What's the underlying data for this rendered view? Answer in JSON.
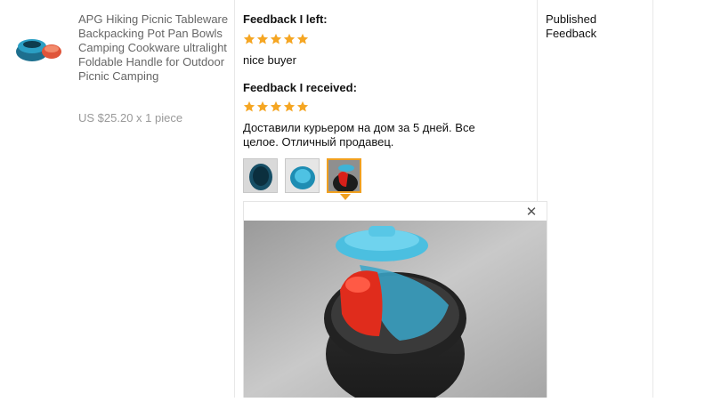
{
  "product": {
    "title": "APG Hiking Picnic Tableware Backpacking Pot Pan Bowls Camping Cookware ultralight Foldable Handle for Outdoor Picnic Camping",
    "price": "US $25.20 x 1 piece",
    "thumbnail_icon": "product-photo"
  },
  "feedback_left": {
    "heading": "Feedback I left:",
    "rating": 5,
    "text": "nice buyer"
  },
  "feedback_received": {
    "heading": "Feedback I received:",
    "rating": 5,
    "text_line1": "Доставили курьером на дом за 5 дней. Все",
    "text_line2": "целое. Отличный продавец.",
    "photos": [
      "photo-1",
      "photo-2",
      "photo-3"
    ],
    "selected_photo": 3
  },
  "preview": {
    "close_icon": "close-icon"
  },
  "status": {
    "line1": "Published",
    "line2": "Feedback"
  },
  "colors": {
    "star": "#f5a623",
    "active_border": "#f0a020"
  }
}
